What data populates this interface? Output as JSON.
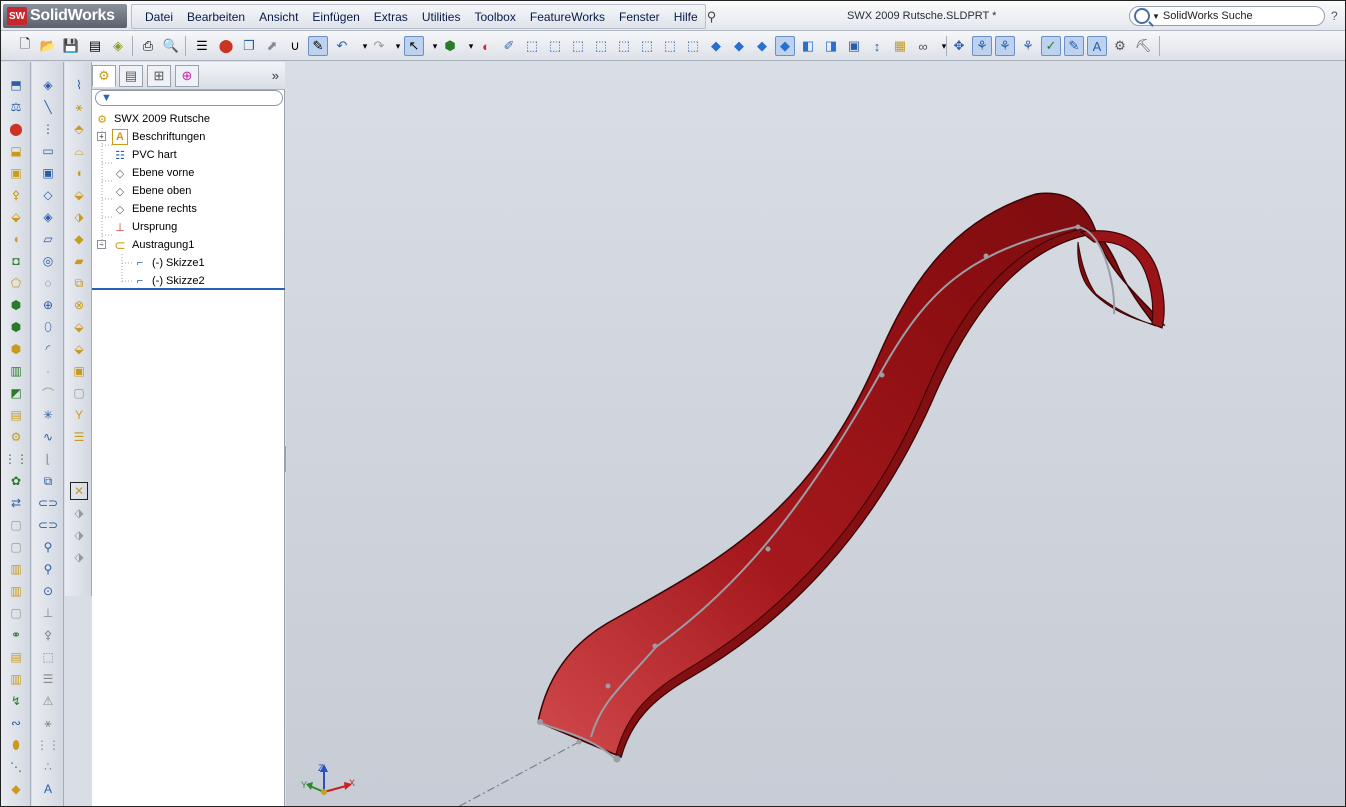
{
  "app": {
    "logo_mark": "SW",
    "logo_text": "SolidWorks",
    "document_title": "SWX 2009 Rutsche.SLDPRT *",
    "search_placeholder": "SolidWorks Suche",
    "help": "?"
  },
  "menu": {
    "items": [
      "Datei",
      "Bearbeiten",
      "Ansicht",
      "Einfügen",
      "Extras",
      "Utilities",
      "Toolbox",
      "FeatureWorks",
      "Fenster",
      "Hilfe"
    ]
  },
  "toolbar": {
    "icons": [
      "new-document",
      "open",
      "save",
      "print-preview",
      "options",
      "print",
      "zoom-preview",
      "properties",
      "rebuild",
      "assembly",
      "smart-mate",
      "undo",
      "redo",
      "select",
      "color",
      "appearance",
      "edit-appearance",
      "view-front",
      "view-back",
      "view-left",
      "view-right",
      "view-top",
      "view-bottom",
      "view-iso",
      "view-trimetric",
      "display-wireframe",
      "display-hidden-lines",
      "display-shaded",
      "display-shaded-edges",
      "section-view",
      "normal-to",
      "zoom-fit",
      "rotate",
      "pan",
      "hide-show",
      "measure",
      "mass-properties",
      "sketch-relations",
      "sketch-snaps",
      "dimension",
      "toolbox",
      "design-library"
    ]
  },
  "feature_tree": {
    "tabs": [
      "feature-manager-tab",
      "property-manager-tab",
      "configuration-manager-tab",
      "dim-xpert-tab"
    ],
    "items": [
      {
        "label": "SWX 2009 Rutsche",
        "icon": "part-icon",
        "level": 0,
        "expander": ""
      },
      {
        "label": "Beschriftungen",
        "icon": "annotations-icon",
        "level": 1,
        "expander": "+"
      },
      {
        "label": "PVC hart",
        "icon": "material-icon",
        "level": 1,
        "expander": ""
      },
      {
        "label": "Ebene vorne",
        "icon": "plane-icon",
        "level": 1,
        "expander": ""
      },
      {
        "label": "Ebene oben",
        "icon": "plane-icon",
        "level": 1,
        "expander": ""
      },
      {
        "label": "Ebene rechts",
        "icon": "plane-icon",
        "level": 1,
        "expander": ""
      },
      {
        "label": "Ursprung",
        "icon": "origin-icon",
        "level": 1,
        "expander": ""
      },
      {
        "label": "Austragung1",
        "icon": "sweep-feature-icon",
        "level": 1,
        "expander": "−"
      },
      {
        "label": "(-) Skizze1",
        "icon": "sketch-icon",
        "level": 2,
        "expander": ""
      },
      {
        "label": "(-) Skizze2",
        "icon": "sketch-icon",
        "level": 2,
        "expander": ""
      }
    ]
  },
  "triad": {
    "x": "X",
    "y": "Y",
    "z": "Z"
  },
  "colors": {
    "slide_body": "#8e0f12",
    "slide_highlight": "#d24a4d",
    "viewport_bg": "#ccd1d9",
    "path_line": "#9a9ea6"
  }
}
